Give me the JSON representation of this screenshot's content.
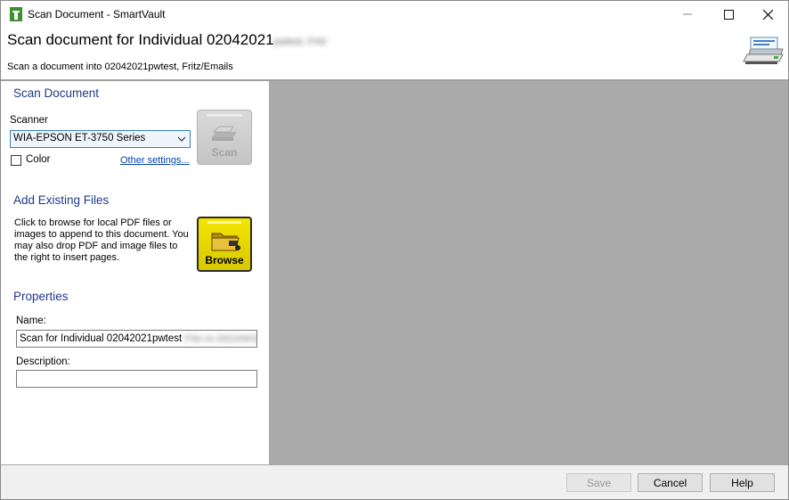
{
  "window": {
    "title": "Scan Document - SmartVault"
  },
  "header": {
    "title_visible": "Scan document for Individual 02042021",
    "title_obscured": "pwtest, Fritz",
    "subtitle": "Scan a document into 02042021pwtest, Fritz/Emails"
  },
  "scan_section": {
    "title": "Scan Document",
    "scanner_label": "Scanner",
    "scanner_selected": "WIA-EPSON ET-3750 Series",
    "color_label": "Color",
    "color_checked": false,
    "other_settings_link": "Other settings...",
    "scan_button_label": "Scan"
  },
  "files_section": {
    "title": "Add Existing Files",
    "description": "Click to browse for local PDF files or images to append to this document.  You may also drop PDF and image files to the right to insert pages.",
    "browse_button_label": "Browse"
  },
  "properties": {
    "title": "Properties",
    "name_label": "Name:",
    "name_value_visible": "Scan for Individual 02042021pwtest",
    "name_value_obscured": "Fritz on 2021/04/16",
    "description_label": "Description:",
    "description_value": ""
  },
  "footer": {
    "save_label": "Save",
    "cancel_label": "Cancel",
    "help_label": "Help"
  },
  "colors": {
    "section_title": "#1f3a8a",
    "link": "#0645ad",
    "preview_bg": "#ababab",
    "browse_yellow": "#f4e600"
  }
}
